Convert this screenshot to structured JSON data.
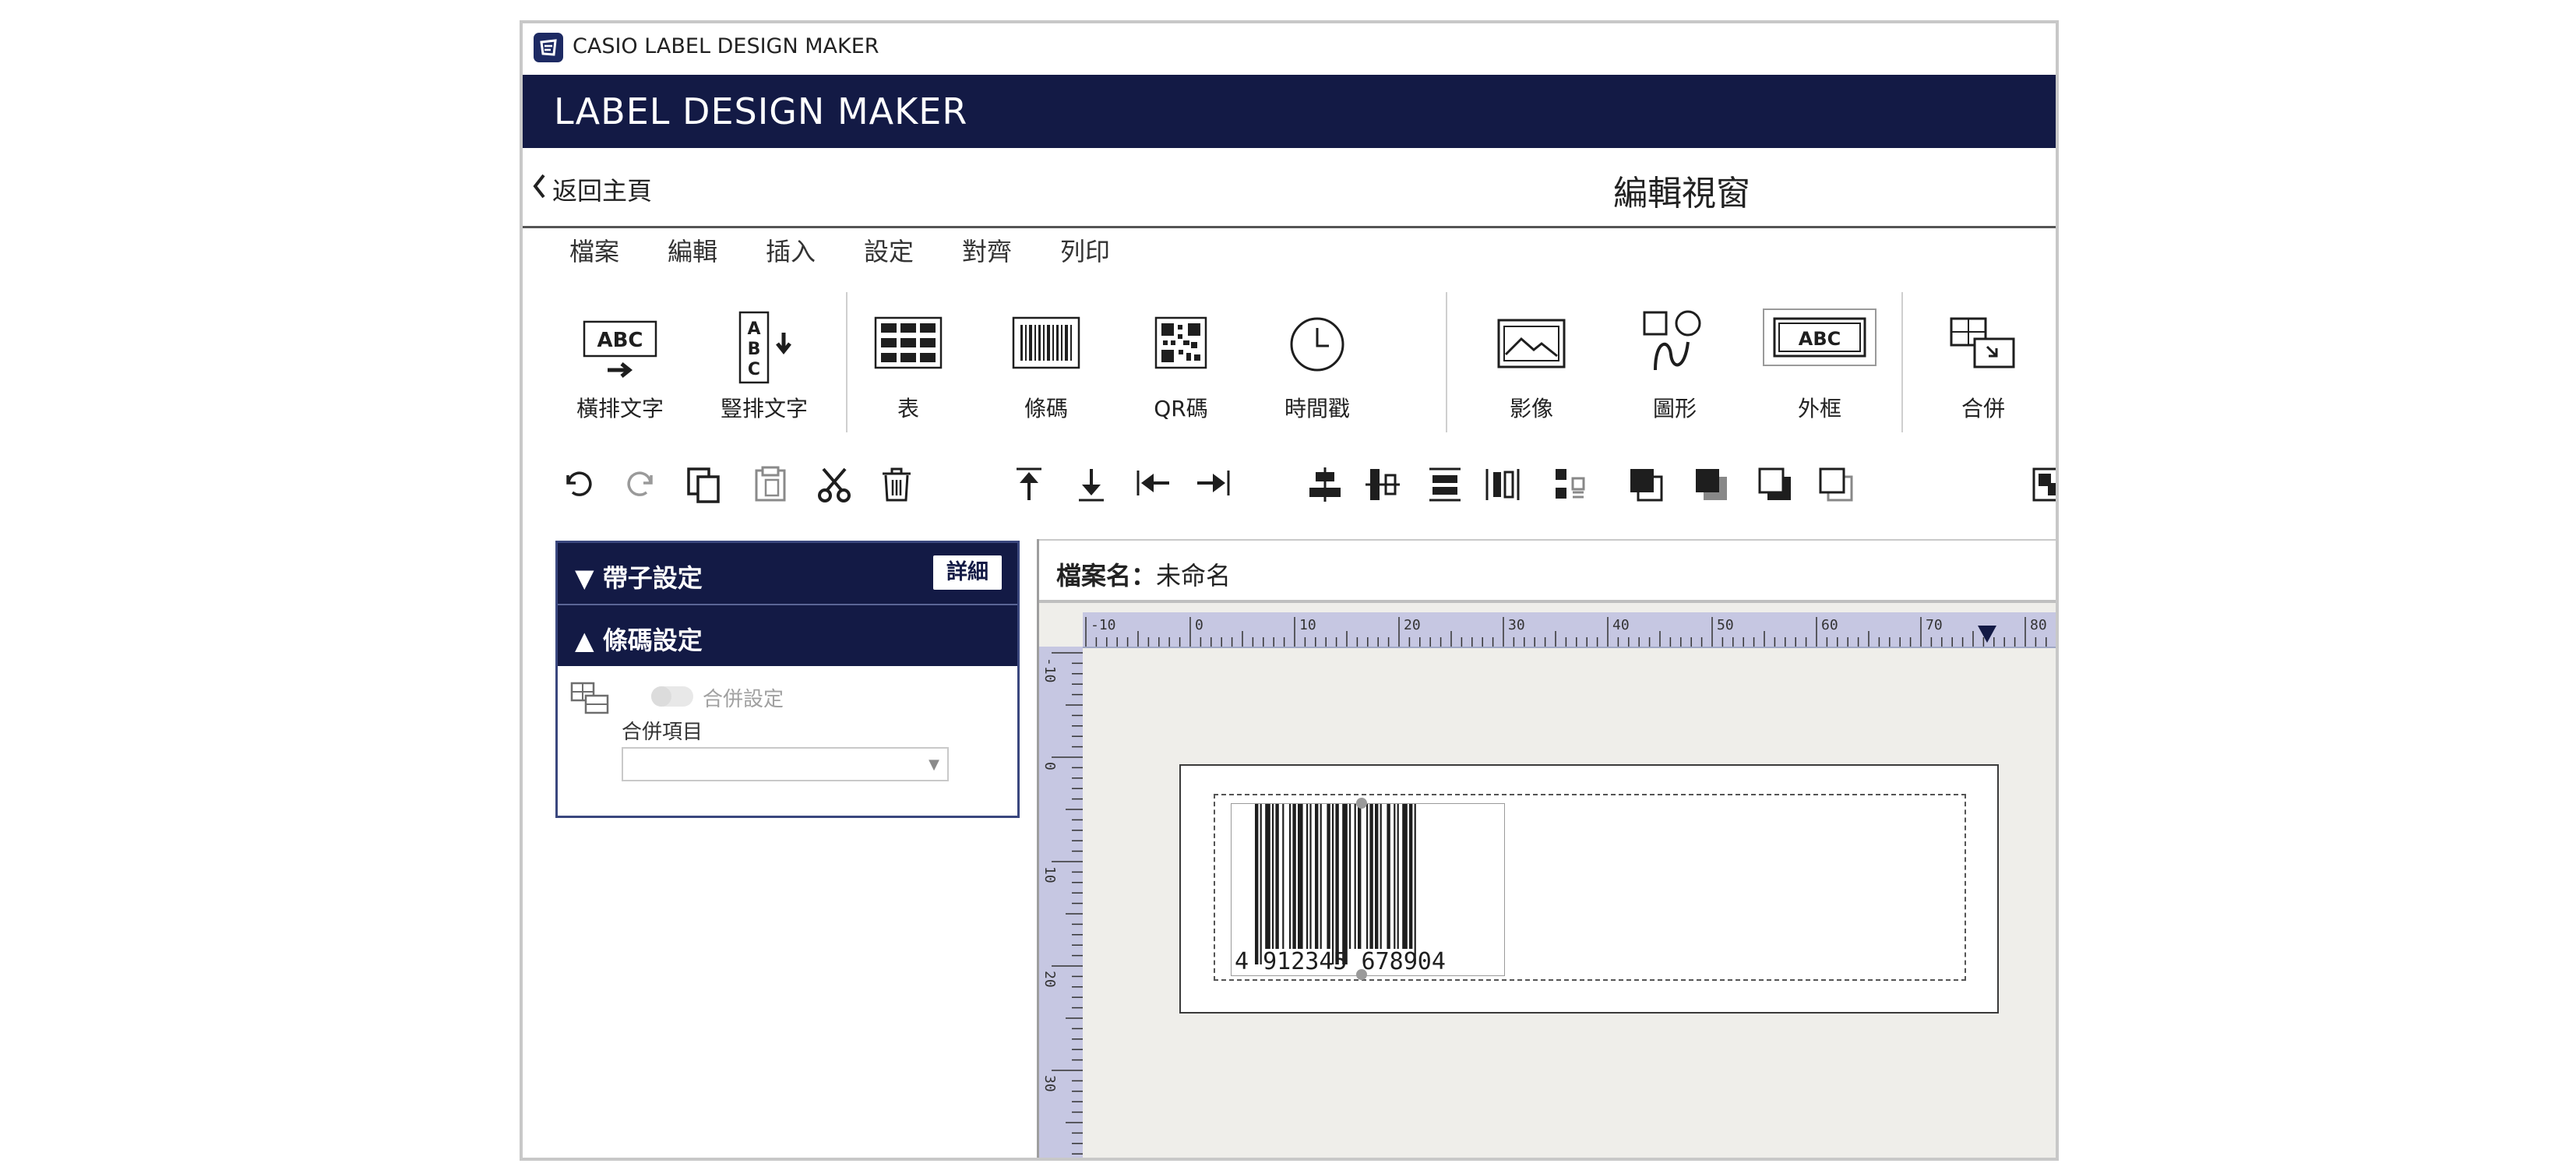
{
  "titlebar": {
    "title": "CASIO LABEL DESIGN MAKER"
  },
  "header": {
    "title": "LABEL DESIGN MAKER"
  },
  "subnav": {
    "back_label": "返回主頁",
    "page_title": "編輯視窗"
  },
  "menu": [
    "檔案",
    "編輯",
    "插入",
    "設定",
    "對齊",
    "列印"
  ],
  "insert_tools": {
    "horizontal_text": "橫排文字",
    "vertical_text": "豎排文字",
    "table": "表",
    "barcode": "條碼",
    "qr": "QR碼",
    "timestamp": "時間戳",
    "image": "影像",
    "shape": "圖形",
    "frame": "外框",
    "merge": "合併",
    "icon_text": {
      "abc": "ABC",
      "a": "A",
      "b": "B",
      "c": "C"
    }
  },
  "panel": {
    "tape_settings": "▼ 帶子設定",
    "detail_button": "詳細",
    "barcode_settings": "▲ 條碼設定",
    "merge_toggle_label": "合併設定",
    "merge_item_label": "合併項目",
    "merge_item_value": "",
    "dropdown_arrow": "▼"
  },
  "document": {
    "filename_label": "檔案名：",
    "filename_value": "未命名"
  },
  "ruler": {
    "h_ticks": [
      "-10",
      "0",
      "10",
      "20",
      "30",
      "40",
      "50",
      "60",
      "70",
      "80"
    ],
    "v_ticks": [
      "-10",
      "0",
      "10",
      "20",
      "30"
    ]
  },
  "barcode": {
    "text": "4 912345 678904"
  },
  "colors": {
    "navy": "#131a45",
    "ruler": "#c6c7e2",
    "canvas": "#efeeea"
  }
}
